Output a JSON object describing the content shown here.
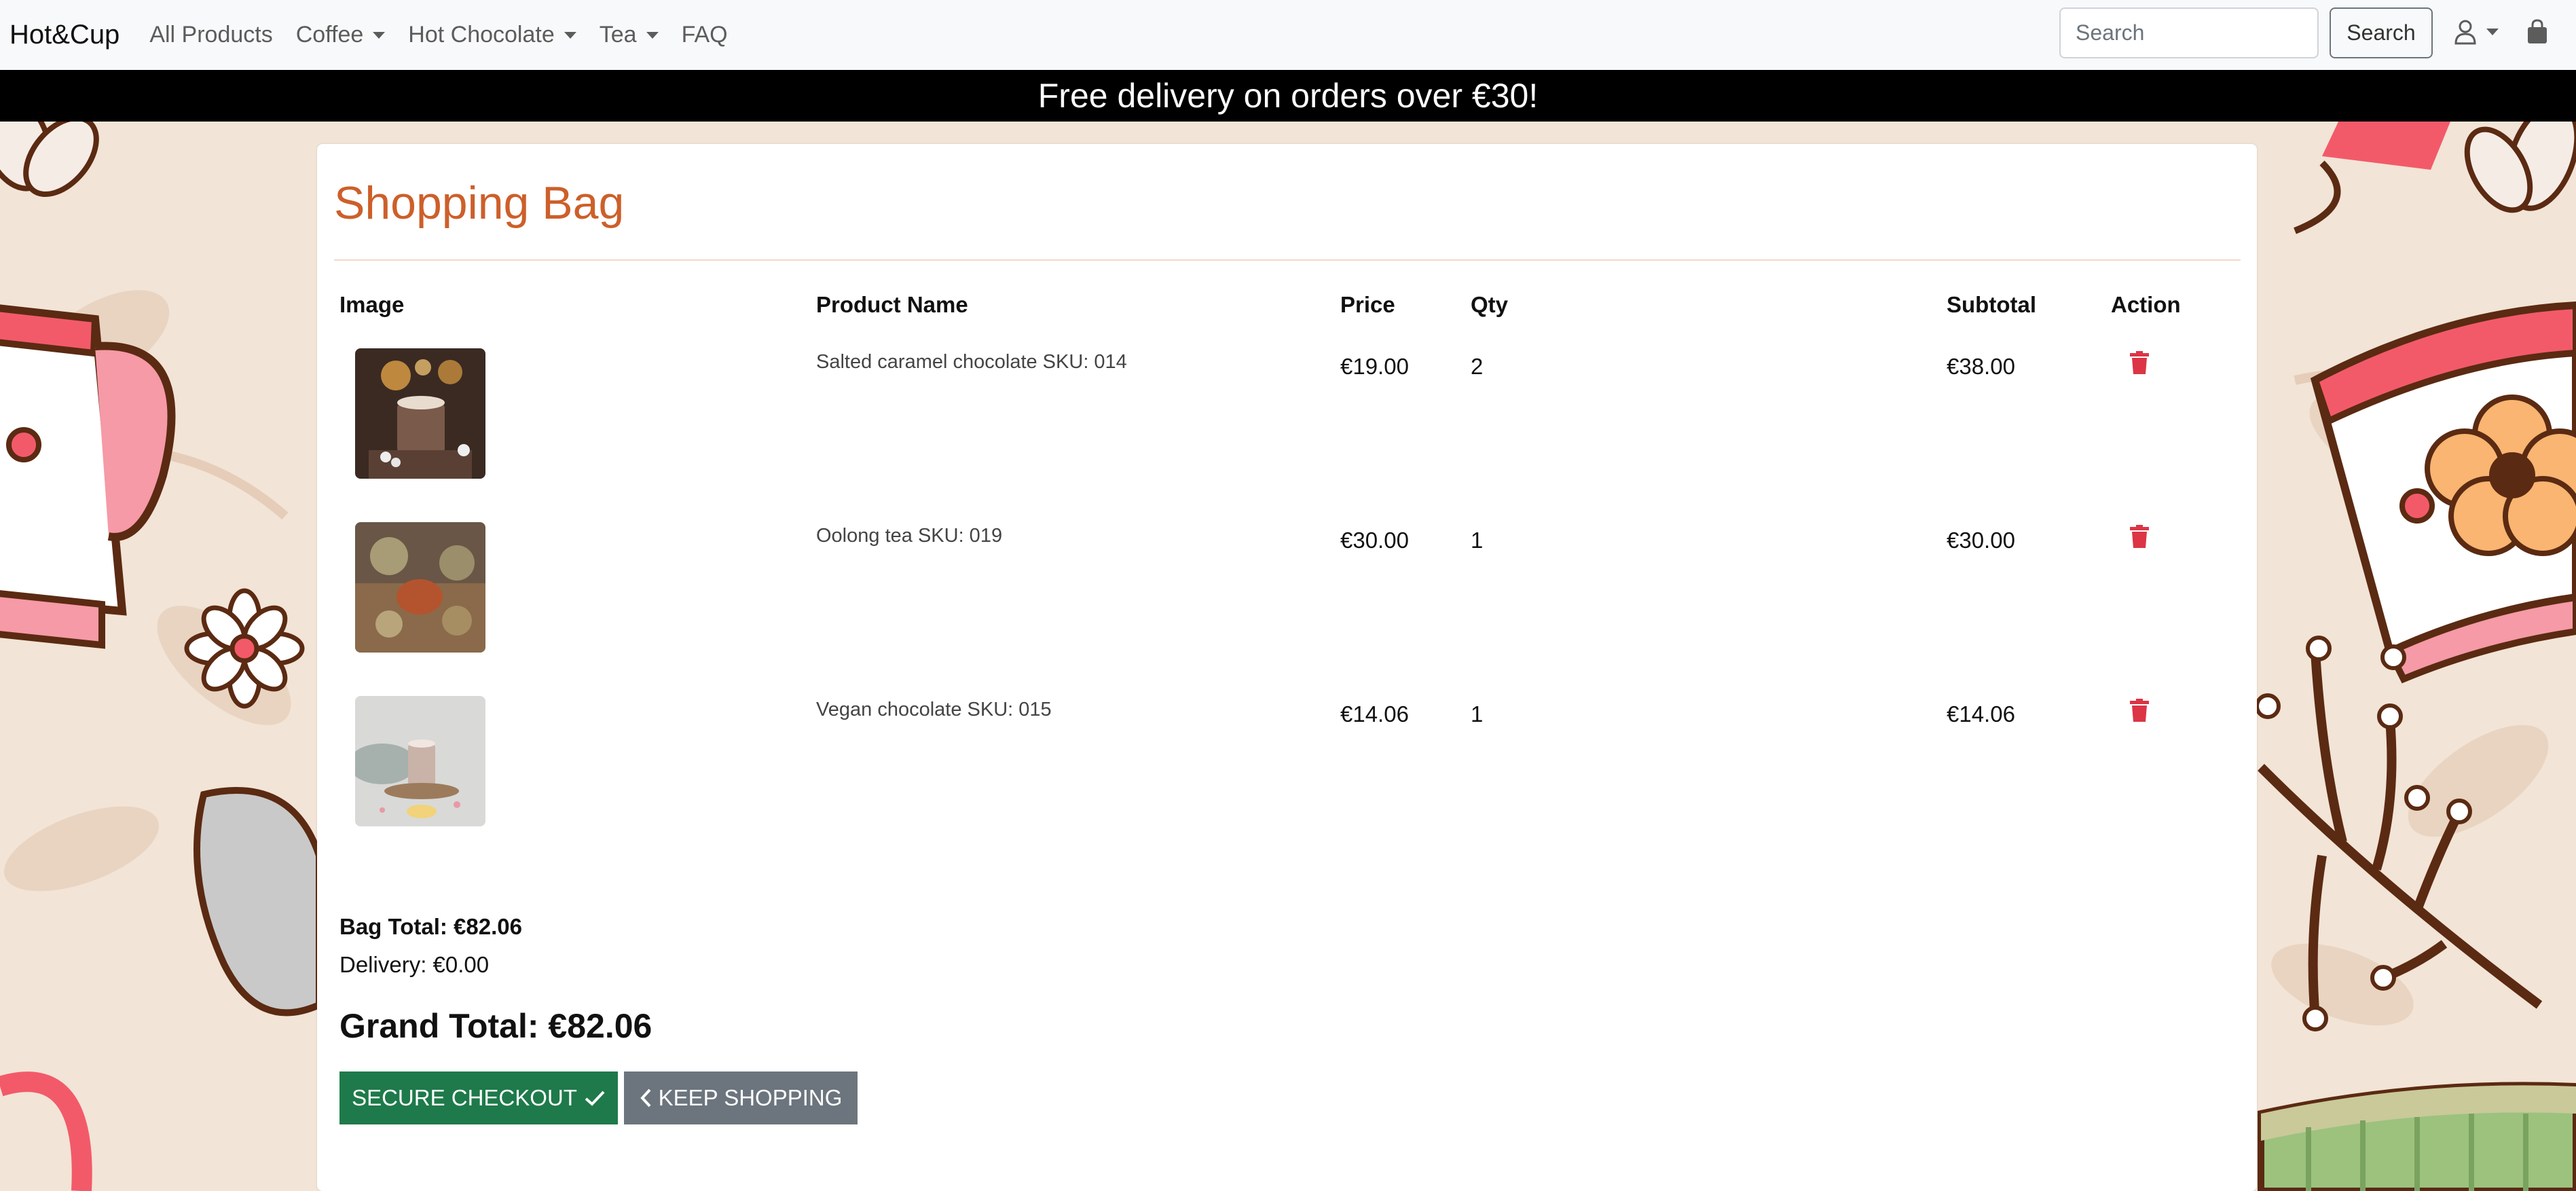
{
  "nav": {
    "brand": "Hot&Cup",
    "links": [
      {
        "label": "All Products"
      },
      {
        "label": "Coffee"
      },
      {
        "label": "Hot Chocolate"
      },
      {
        "label": "Tea"
      },
      {
        "label": "FAQ"
      }
    ],
    "search_placeholder": "Search",
    "search_button": "Search"
  },
  "banner": {
    "text": "Free delivery on orders over €30!"
  },
  "bag": {
    "title": "Shopping Bag",
    "headers": {
      "image": "Image",
      "product_name": "Product Name",
      "price": "Price",
      "qty": "Qty",
      "subtotal": "Subtotal",
      "action": "Action"
    },
    "items": [
      {
        "name": "Salted caramel chocolate SKU: 014",
        "price": "€19.00",
        "qty": "2",
        "subtotal": "€38.00",
        "image_icon": "hot-chocolate-photo"
      },
      {
        "name": "Oolong tea SKU: 019",
        "price": "€30.00",
        "qty": "1",
        "subtotal": "€30.00",
        "image_icon": "oolong-tea-photo"
      },
      {
        "name": "Vegan chocolate SKU: 015",
        "price": "€14.06",
        "qty": "1",
        "subtotal": "€14.06",
        "image_icon": "vegan-chocolate-photo"
      }
    ],
    "bag_total": "Bag Total: €82.06",
    "delivery": "Delivery: €0.00",
    "grand_total": "Grand Total: €82.06",
    "checkout_label": "SECURE CHECKOUT",
    "keep_shopping_label": "KEEP SHOPPING"
  },
  "colors": {
    "accent": "#cd5f2a",
    "checkout": "#1e7a4a",
    "secondary": "#6c757d",
    "delete": "#dc3545",
    "banner_bg": "#000000"
  }
}
